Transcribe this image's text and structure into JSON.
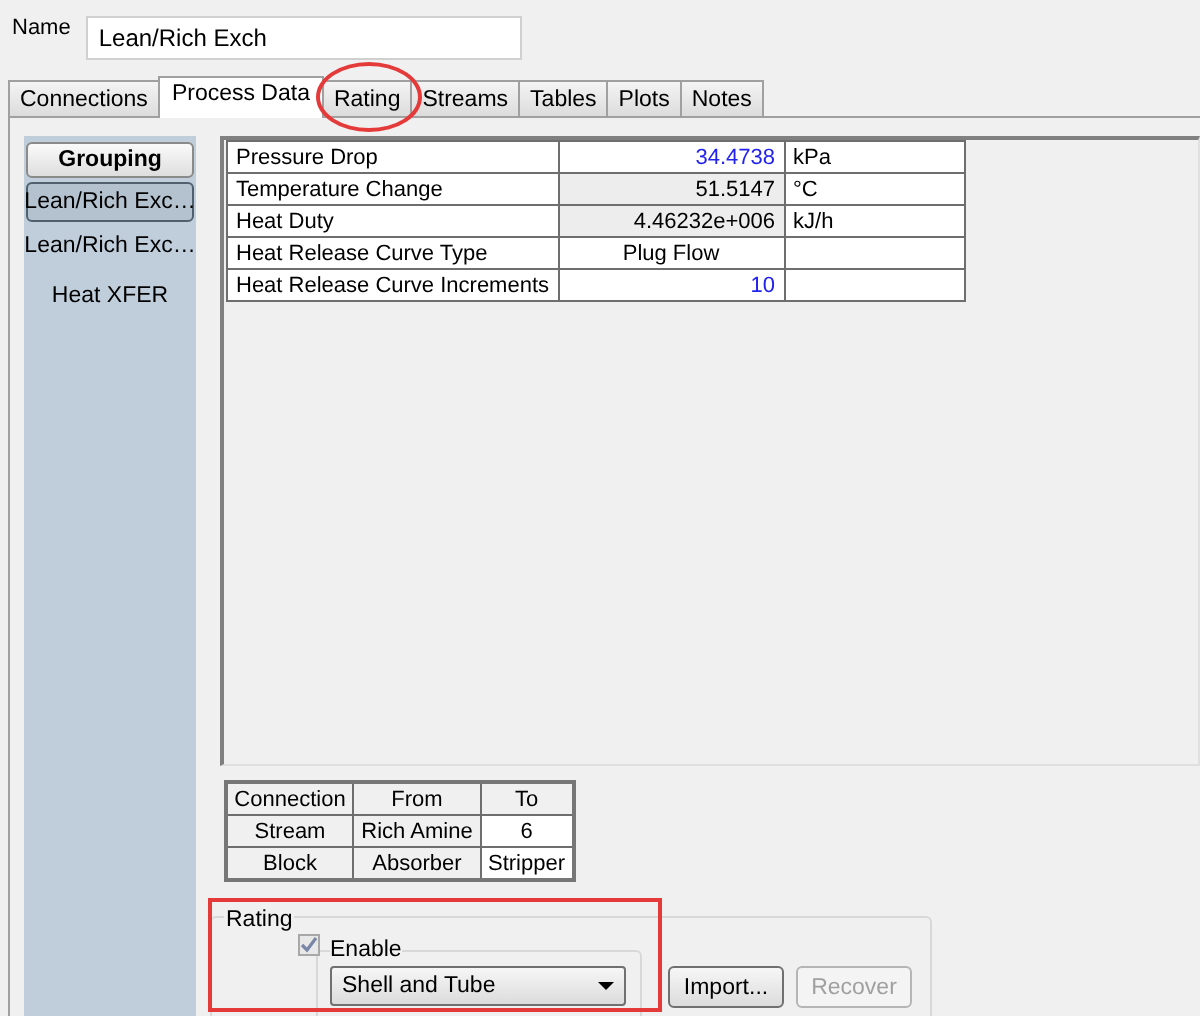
{
  "name_field": {
    "label": "Name",
    "value": "Lean/Rich Exch"
  },
  "tabs": [
    {
      "label": "Connections",
      "selected": false,
      "circled": false
    },
    {
      "label": "Process Data",
      "selected": true,
      "circled": false
    },
    {
      "label": "Rating",
      "selected": false,
      "circled": true
    },
    {
      "label": "Streams",
      "selected": false,
      "circled": false
    },
    {
      "label": "Tables",
      "selected": false,
      "circled": false
    },
    {
      "label": "Plots",
      "selected": false,
      "circled": false
    },
    {
      "label": "Notes",
      "selected": false,
      "circled": false
    }
  ],
  "sidebar": {
    "header": "Grouping",
    "items": [
      {
        "label": "Lean/Rich Exc…",
        "selected": true
      },
      {
        "label": "Lean/Rich Exc…",
        "selected": false
      },
      {
        "label": "Heat XFER",
        "selected": false
      }
    ]
  },
  "properties": {
    "rows": [
      {
        "label": "Pressure Drop",
        "value": "34.4738",
        "unit": "kPa",
        "kind": "input"
      },
      {
        "label": "Temperature Change",
        "value": "51.5147",
        "unit": "°C",
        "kind": "calculated"
      },
      {
        "label": "Heat Duty",
        "value": "4.46232e+006",
        "unit": "kJ/h",
        "kind": "calculated"
      },
      {
        "label": "Heat Release Curve Type",
        "value": "Plug Flow",
        "kind": "choice"
      },
      {
        "label": "Heat Release Curve Increments",
        "value": "10",
        "kind": "input"
      }
    ]
  },
  "connections": {
    "columns": [
      "Connection",
      "From",
      "To"
    ],
    "rows": [
      [
        "Stream",
        "Rich Amine",
        "6"
      ],
      [
        "Block",
        "Absorber",
        "Stripper"
      ]
    ]
  },
  "rating": {
    "title": "Rating",
    "outlined": true,
    "enable": {
      "label": "Enable",
      "checked": true,
      "disabled": true
    },
    "method": {
      "value": "Shell and Tube"
    },
    "buttons": [
      {
        "label": "Import...",
        "disabled": false
      },
      {
        "label": "Recover",
        "disabled": true
      }
    ]
  }
}
